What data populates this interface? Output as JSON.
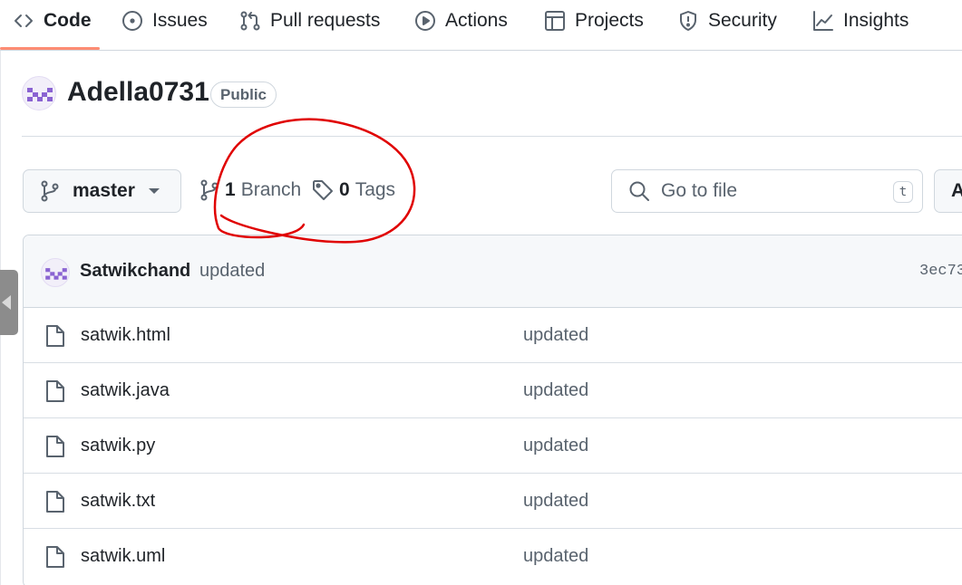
{
  "nav": {
    "tabs": [
      {
        "label": "Code",
        "icon": "code-icon"
      },
      {
        "label": "Issues",
        "icon": "issue-icon"
      },
      {
        "label": "Pull requests",
        "icon": "pull-request-icon"
      },
      {
        "label": "Actions",
        "icon": "play-icon"
      },
      {
        "label": "Projects",
        "icon": "table-icon"
      },
      {
        "label": "Security",
        "icon": "shield-icon"
      },
      {
        "label": "Insights",
        "icon": "graph-icon"
      }
    ],
    "active_tab": "Code"
  },
  "repo": {
    "name": "Adella0731",
    "visibility": "Public"
  },
  "branch_bar": {
    "current_branch": "master",
    "branches_count": "1",
    "branches_label": "Branch",
    "tags_count": "0",
    "tags_label": "Tags",
    "go_to_file_placeholder": "Go to file",
    "go_to_file_shortcut": "t",
    "add_file_label": "A"
  },
  "latest_commit": {
    "author": "Satwikchand",
    "message": "updated",
    "sha": "3ec73"
  },
  "files": [
    {
      "name": "satwik.html",
      "message": "updated"
    },
    {
      "name": "satwik.java",
      "message": "updated"
    },
    {
      "name": "satwik.py",
      "message": "updated"
    },
    {
      "name": "satwik.txt",
      "message": "updated"
    },
    {
      "name": "satwik.uml",
      "message": "updated"
    }
  ],
  "colors": {
    "tab_underline": "#fd8c73",
    "annotation": "#e00000",
    "avatar_purple": "#8a63d2"
  }
}
